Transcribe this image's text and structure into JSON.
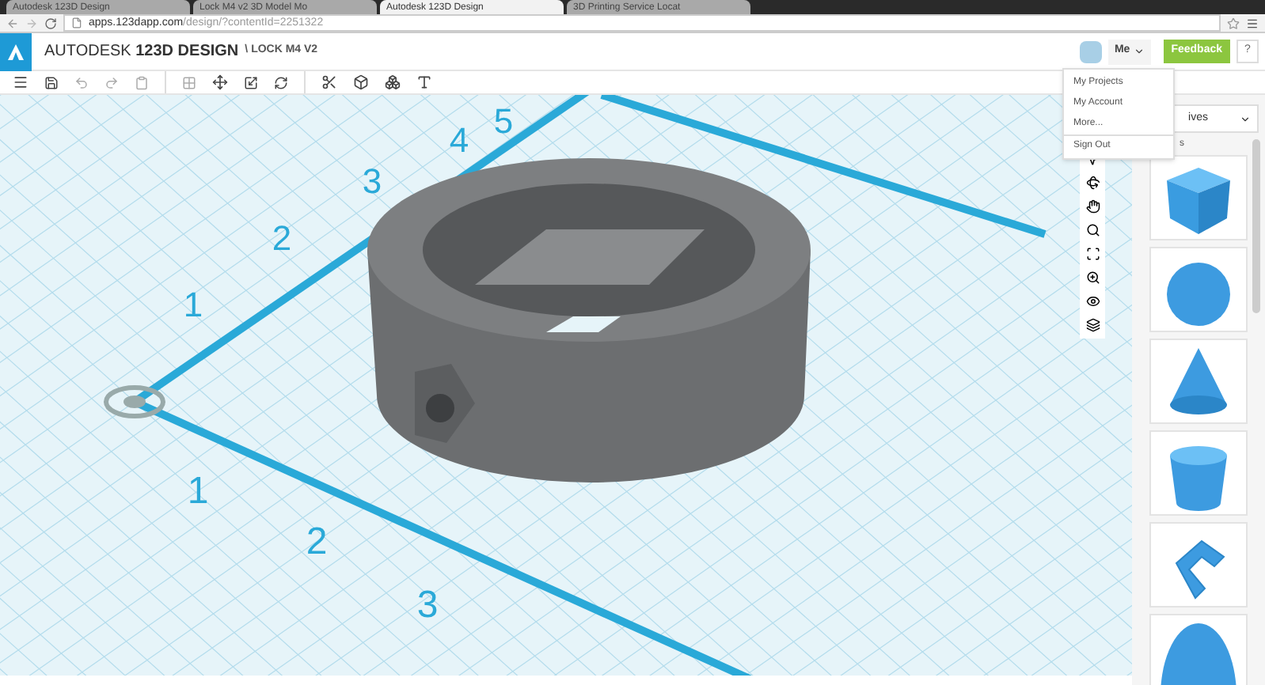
{
  "browser": {
    "tabs": [
      {
        "label": "Autodesk 123D Design",
        "selected": false
      },
      {
        "label": "Lock M4 v2 3D Model Mo",
        "selected": false
      },
      {
        "label": "Autodesk 123D Design",
        "selected": true
      },
      {
        "label": "3D Printing Service Locat",
        "selected": false
      }
    ],
    "url_host": "apps.123dapp.com",
    "url_path": "/design/?contentId=2251322"
  },
  "app": {
    "brand": "AUTODESK",
    "product": "123D DESIGN",
    "separator": "\\",
    "document": "LOCK M4 V2",
    "user": "Me",
    "feedback": "Feedback",
    "help": "?"
  },
  "user_menu": [
    {
      "label": "My Projects",
      "divider_before": false
    },
    {
      "label": "My Account",
      "divider_before": false
    },
    {
      "label": "More...",
      "divider_before": false
    },
    {
      "label": "Sign Out",
      "divider_before": true
    }
  ],
  "canvas": {
    "axis_y_labels": [
      "1",
      "2",
      "3",
      "4",
      "5"
    ],
    "axis_x_labels": [
      "1",
      "2",
      "3"
    ]
  },
  "panel": {
    "category": "ives",
    "heading": "s",
    "shapes": [
      {
        "kind": "box"
      },
      {
        "kind": "sphere"
      },
      {
        "kind": "cone"
      },
      {
        "kind": "cylinder"
      },
      {
        "kind": "bracket"
      },
      {
        "kind": "hemisphere"
      }
    ]
  }
}
